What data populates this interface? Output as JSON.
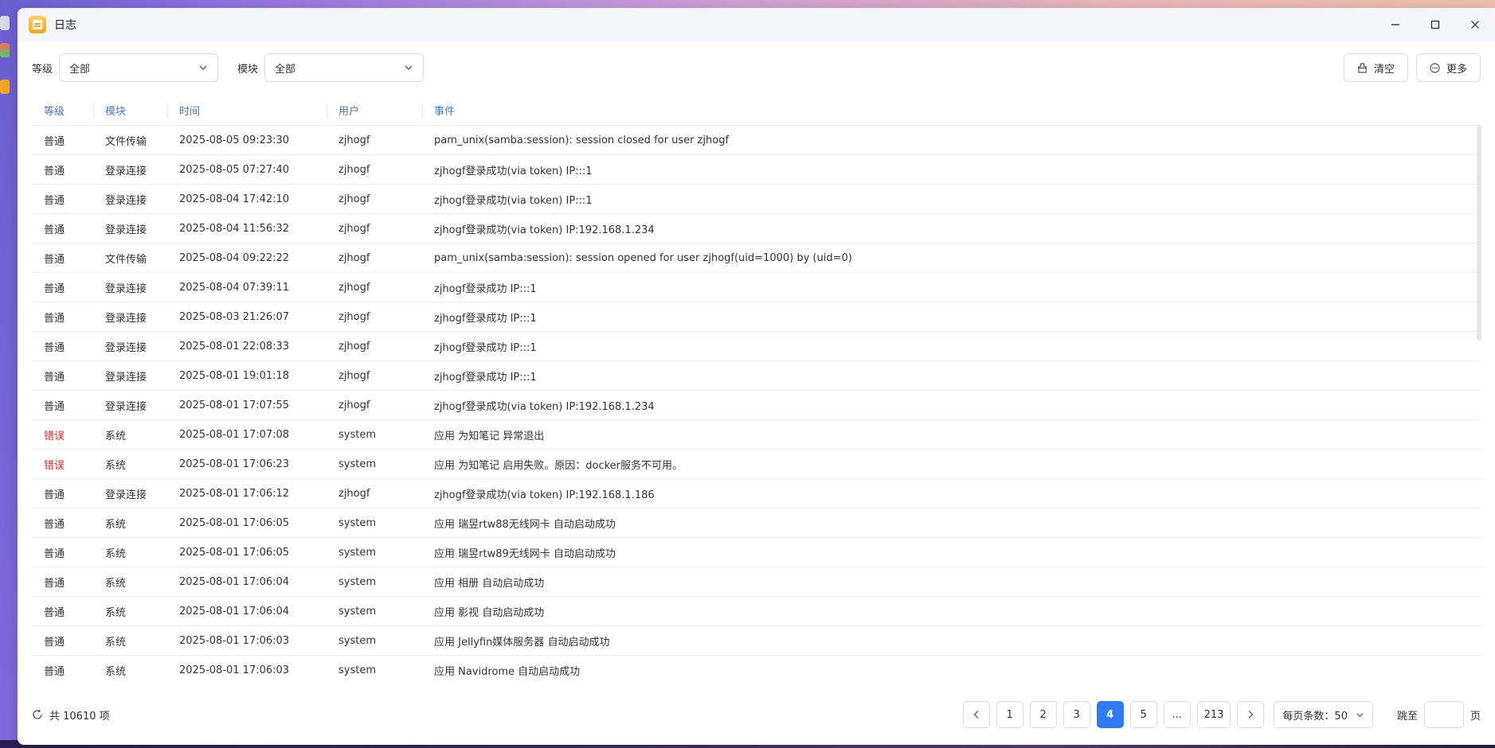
{
  "window": {
    "title": "日志",
    "icon": "log-app-icon",
    "controls": [
      "minimize-icon",
      "maximize-icon",
      "close-icon"
    ]
  },
  "filters": {
    "level_label": "等级",
    "level_value": "全部",
    "module_label": "模块",
    "module_value": "全部"
  },
  "actions": {
    "clear_label": "清空",
    "more_label": "更多"
  },
  "table": {
    "headers": [
      "等级",
      "模块",
      "时间",
      "用户",
      "事件"
    ],
    "rows": [
      [
        "普通",
        "文件传输",
        "2025-08-05 09:23:30",
        "zjhogf",
        "pam_unix(samba:session): session closed for user zjhogf"
      ],
      [
        "普通",
        "登录连接",
        "2025-08-05 07:27:40",
        "zjhogf",
        "zjhogf登录成功(via token) IP:::1"
      ],
      [
        "普通",
        "登录连接",
        "2025-08-04 17:42:10",
        "zjhogf",
        "zjhogf登录成功(via token) IP:::1"
      ],
      [
        "普通",
        "登录连接",
        "2025-08-04 11:56:32",
        "zjhogf",
        "zjhogf登录成功(via token) IP:192.168.1.234"
      ],
      [
        "普通",
        "文件传输",
        "2025-08-04 09:22:22",
        "zjhogf",
        "pam_unix(samba:session): session opened for user zjhogf(uid=1000) by (uid=0)"
      ],
      [
        "普通",
        "登录连接",
        "2025-08-04 07:39:11",
        "zjhogf",
        "zjhogf登录成功 IP:::1"
      ],
      [
        "普通",
        "登录连接",
        "2025-08-03 21:26:07",
        "zjhogf",
        "zjhogf登录成功 IP:::1"
      ],
      [
        "普通",
        "登录连接",
        "2025-08-01 22:08:33",
        "zjhogf",
        "zjhogf登录成功 IP:::1"
      ],
      [
        "普通",
        "登录连接",
        "2025-08-01 19:01:18",
        "zjhogf",
        "zjhogf登录成功 IP:::1"
      ],
      [
        "普通",
        "登录连接",
        "2025-08-01 17:07:55",
        "zjhogf",
        "zjhogf登录成功(via token) IP:192.168.1.234"
      ],
      [
        "错误",
        "系统",
        "2025-08-01 17:07:08",
        "system",
        "应用 为知笔记 异常退出"
      ],
      [
        "错误",
        "系统",
        "2025-08-01 17:06:23",
        "system",
        "应用 为知笔记 启用失败。原因：docker服务不可用。"
      ],
      [
        "普通",
        "登录连接",
        "2025-08-01 17:06:12",
        "zjhogf",
        "zjhogf登录成功(via token) IP:192.168.1.186"
      ],
      [
        "普通",
        "系统",
        "2025-08-01 17:06:05",
        "system",
        "应用 瑞昱rtw88无线网卡 自动启动成功"
      ],
      [
        "普通",
        "系统",
        "2025-08-01 17:06:05",
        "system",
        "应用 瑞昱rtw89无线网卡 自动启动成功"
      ],
      [
        "普通",
        "系统",
        "2025-08-01 17:06:04",
        "system",
        "应用 相册 自动启动成功"
      ],
      [
        "普通",
        "系统",
        "2025-08-01 17:06:04",
        "system",
        "应用 影视 自动启动成功"
      ],
      [
        "普通",
        "系统",
        "2025-08-01 17:06:03",
        "system",
        "应用 Jellyfin媒体服务器 自动启动成功"
      ],
      [
        "普通",
        "系统",
        "2025-08-01 17:06:03",
        "system",
        "应用 Navidrome 自动启动成功"
      ]
    ],
    "error_level": "错误",
    "error_color": "#e5242b"
  },
  "footer": {
    "total_text": "共 10610 项",
    "pages": [
      "1",
      "2",
      "3",
      "4",
      "5",
      "...",
      "213"
    ],
    "current_page": "4",
    "per_page_text": "每页条数：50",
    "jump_label": "跳至",
    "jump_suffix": "页",
    "jump_value": ""
  },
  "colors": {
    "accent": "#2f7bf5",
    "header_text": "#4a78b8"
  }
}
